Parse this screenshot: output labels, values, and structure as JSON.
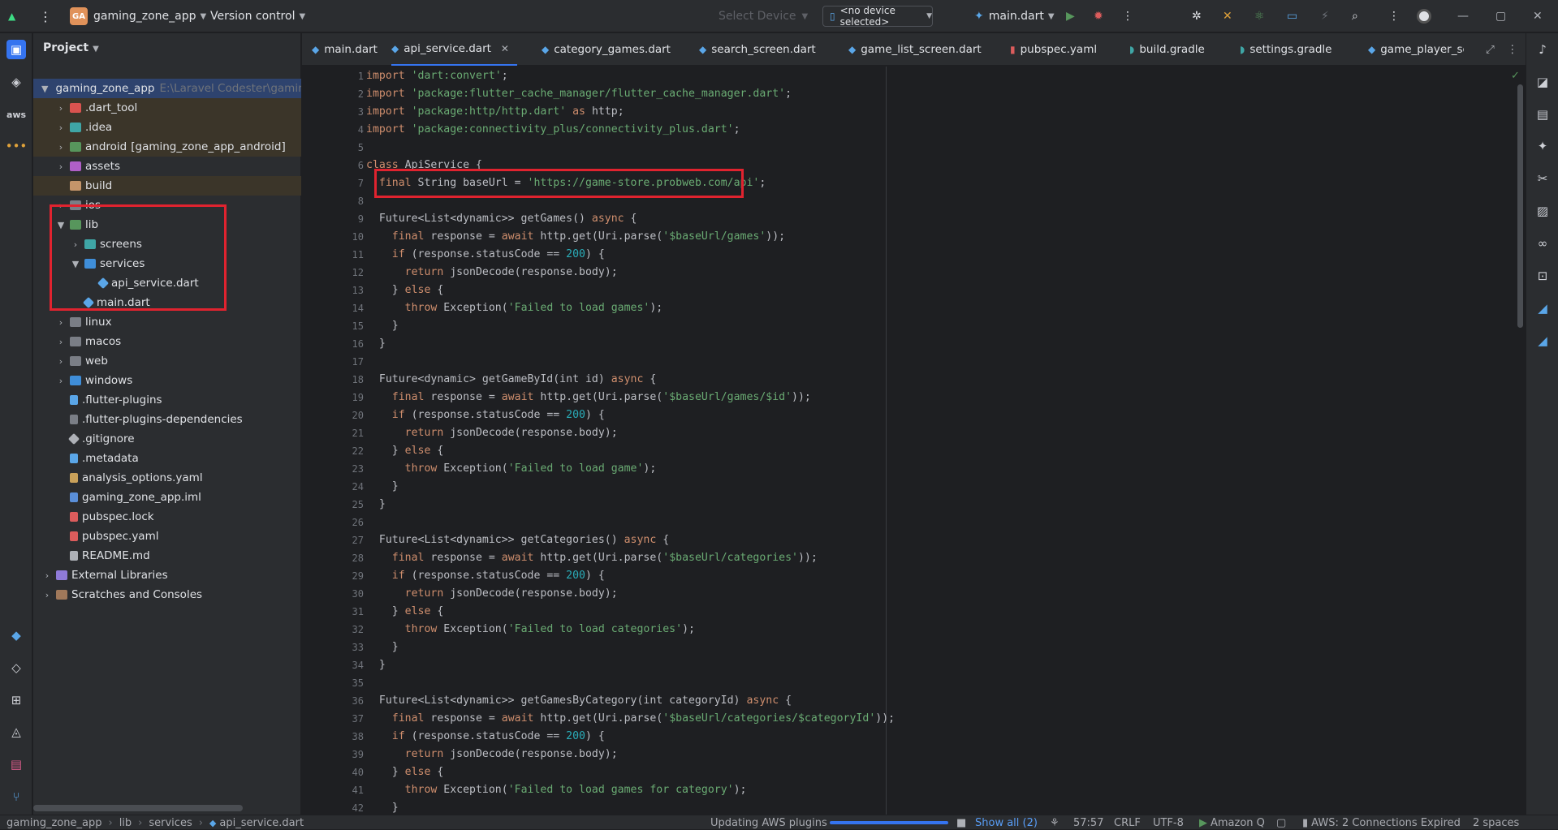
{
  "titlebar": {
    "app_badge": "GA",
    "project_name": "gaming_zone_app",
    "vcs_label": "Version control",
    "select_device": "Select Device",
    "no_device": "<no device selected>",
    "run_config": "main.dart"
  },
  "project_panel": {
    "title": "Project",
    "root": {
      "name": "gaming_zone_app",
      "path": "E:\\Laravel Codester\\gamin"
    },
    "items": [
      {
        "label": ".dart_tool",
        "extra": ""
      },
      {
        "label": ".idea",
        "extra": ""
      },
      {
        "label": "android",
        "extra": "[gaming_zone_app_android]"
      },
      {
        "label": "assets",
        "extra": ""
      },
      {
        "label": "build",
        "extra": ""
      },
      {
        "label": "ios",
        "extra": ""
      },
      {
        "label": "lib",
        "extra": ""
      },
      {
        "label": "screens",
        "extra": ""
      },
      {
        "label": "services",
        "extra": ""
      },
      {
        "label": "api_service.dart",
        "extra": ""
      },
      {
        "label": "main.dart",
        "extra": ""
      },
      {
        "label": "linux",
        "extra": ""
      },
      {
        "label": "macos",
        "extra": ""
      },
      {
        "label": "web",
        "extra": ""
      },
      {
        "label": "windows",
        "extra": ""
      },
      {
        "label": ".flutter-plugins",
        "extra": ""
      },
      {
        "label": ".flutter-plugins-dependencies",
        "extra": ""
      },
      {
        "label": ".gitignore",
        "extra": ""
      },
      {
        "label": ".metadata",
        "extra": ""
      },
      {
        "label": "analysis_options.yaml",
        "extra": ""
      },
      {
        "label": "gaming_zone_app.iml",
        "extra": ""
      },
      {
        "label": "pubspec.lock",
        "extra": ""
      },
      {
        "label": "pubspec.yaml",
        "extra": ""
      },
      {
        "label": "README.md",
        "extra": ""
      },
      {
        "label": "External Libraries",
        "extra": ""
      },
      {
        "label": "Scratches and Consoles",
        "extra": ""
      }
    ]
  },
  "tabs": [
    {
      "label": "main.dart"
    },
    {
      "label": "api_service.dart"
    },
    {
      "label": "category_games.dart"
    },
    {
      "label": "search_screen.dart"
    },
    {
      "label": "game_list_screen.dart"
    },
    {
      "label": "pubspec.yaml"
    },
    {
      "label": "build.gradle"
    },
    {
      "label": "settings.gradle"
    },
    {
      "label": "game_player_scre"
    }
  ],
  "code_lines": [
    "import 'dart:convert';",
    "import 'package:flutter_cache_manager/flutter_cache_manager.dart';",
    "import 'package:http/http.dart' as http;",
    "import 'package:connectivity_plus/connectivity_plus.dart';",
    "",
    "class ApiService {",
    "  final String baseUrl = 'https://game-store.probweb.com/api';",
    "",
    "  Future<List<dynamic>> getGames() async {",
    "    final response = await http.get(Uri.parse('$baseUrl/games'));",
    "    if (response.statusCode == 200) {",
    "      return jsonDecode(response.body);",
    "    } else {",
    "      throw Exception('Failed to load games');",
    "    }",
    "  }",
    "",
    "  Future<dynamic> getGameById(int id) async {",
    "    final response = await http.get(Uri.parse('$baseUrl/games/$id'));",
    "    if (response.statusCode == 200) {",
    "      return jsonDecode(response.body);",
    "    } else {",
    "      throw Exception('Failed to load game');",
    "    }",
    "  }",
    "",
    "  Future<List<dynamic>> getCategories() async {",
    "    final response = await http.get(Uri.parse('$baseUrl/categories'));",
    "    if (response.statusCode == 200) {",
    "      return jsonDecode(response.body);",
    "    } else {",
    "      throw Exception('Failed to load categories');",
    "    }",
    "  }",
    "",
    "  Future<List<dynamic>> getGamesByCategory(int categoryId) async {",
    "    final response = await http.get(Uri.parse('$baseUrl/categories/$categoryId'));",
    "    if (response.statusCode == 200) {",
    "      return jsonDecode(response.body);",
    "    } else {",
    "      throw Exception('Failed to load games for category');",
    "    }"
  ],
  "statusbar": {
    "breadcrumb": [
      "gaming_zone_app",
      "lib",
      "services",
      "api_service.dart"
    ],
    "task": "Updating AWS plugins",
    "show_all": "Show all (2)",
    "position": "57:57",
    "line_sep": "CRLF",
    "encoding": "UTF-8",
    "amazon_q": "Amazon Q",
    "aws": "AWS: 2 Connections Expired",
    "indent": "2 spaces"
  },
  "colors": {
    "accent": "#3574f0",
    "highlight_box": "#e0232f"
  }
}
